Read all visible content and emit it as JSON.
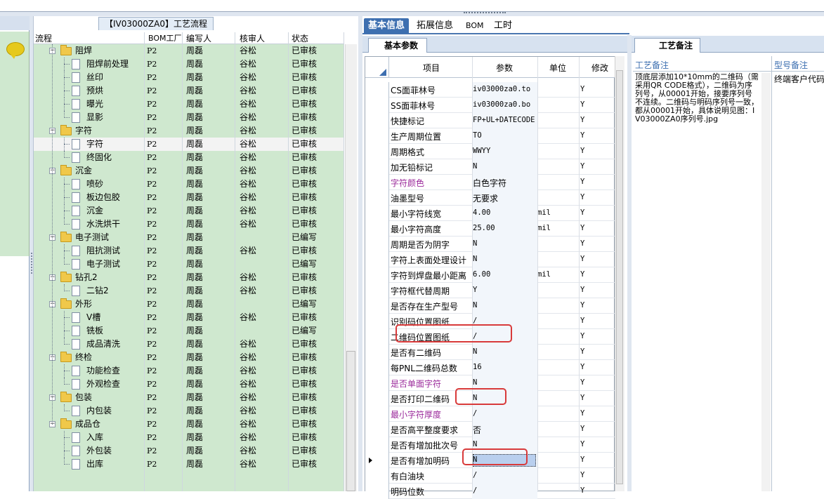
{
  "tree": {
    "title": "【IV03000ZA0】工艺流程",
    "headers": {
      "flow": "流程",
      "bom": "BOM工厂",
      "writer": "编写人",
      "checker": "核审人",
      "status": "状态"
    },
    "rows": [
      {
        "type": "folder",
        "name": "阻焊",
        "bom": "P2",
        "writer": "周磊",
        "checker": "谷松",
        "status": "已审核"
      },
      {
        "type": "doc",
        "name": "阻焊前处理",
        "bom": "P2",
        "writer": "周磊",
        "checker": "谷松",
        "status": "已审核"
      },
      {
        "type": "doc",
        "name": "丝印",
        "bom": "P2",
        "writer": "周磊",
        "checker": "谷松",
        "status": "已审核"
      },
      {
        "type": "doc",
        "name": "预烘",
        "bom": "P2",
        "writer": "周磊",
        "checker": "谷松",
        "status": "已审核"
      },
      {
        "type": "doc",
        "name": "曝光",
        "bom": "P2",
        "writer": "周磊",
        "checker": "谷松",
        "status": "已审核"
      },
      {
        "type": "doc",
        "name": "显影",
        "bom": "P2",
        "writer": "周磊",
        "checker": "谷松",
        "status": "已审核",
        "last": true
      },
      {
        "type": "folder",
        "name": "字符",
        "bom": "P2",
        "writer": "周磊",
        "checker": "谷松",
        "status": "已审核"
      },
      {
        "type": "doc",
        "name": "字符",
        "bom": "P2",
        "writer": "周磊",
        "checker": "谷松",
        "status": "已审核",
        "selected": true
      },
      {
        "type": "doc",
        "name": "终固化",
        "bom": "P2",
        "writer": "周磊",
        "checker": "谷松",
        "status": "已审核",
        "last": true
      },
      {
        "type": "folder",
        "name": "沉金",
        "bom": "P2",
        "writer": "周磊",
        "checker": "谷松",
        "status": "已审核"
      },
      {
        "type": "doc",
        "name": "喷砂",
        "bom": "P2",
        "writer": "周磊",
        "checker": "谷松",
        "status": "已审核"
      },
      {
        "type": "doc",
        "name": "板边包胶",
        "bom": "P2",
        "writer": "周磊",
        "checker": "谷松",
        "status": "已审核"
      },
      {
        "type": "doc",
        "name": "沉金",
        "bom": "P2",
        "writer": "周磊",
        "checker": "谷松",
        "status": "已审核"
      },
      {
        "type": "doc",
        "name": "水洗烘干",
        "bom": "P2",
        "writer": "周磊",
        "checker": "谷松",
        "status": "已审核",
        "last": true
      },
      {
        "type": "folder",
        "name": "电子测试",
        "bom": "P2",
        "writer": "周磊",
        "checker": "",
        "status": "已编写"
      },
      {
        "type": "doc",
        "name": "阻抗测试",
        "bom": "P2",
        "writer": "周磊",
        "checker": "谷松",
        "status": "已审核"
      },
      {
        "type": "doc",
        "name": "电子测试",
        "bom": "P2",
        "writer": "周磊",
        "checker": "",
        "status": "已编写",
        "last": true
      },
      {
        "type": "folder",
        "name": "钻孔2",
        "bom": "P2",
        "writer": "周磊",
        "checker": "谷松",
        "status": "已审核"
      },
      {
        "type": "doc",
        "name": "二钻2",
        "bom": "P2",
        "writer": "周磊",
        "checker": "谷松",
        "status": "已审核",
        "last": true
      },
      {
        "type": "folder",
        "name": "外形",
        "bom": "P2",
        "writer": "周磊",
        "checker": "",
        "status": "已编写"
      },
      {
        "type": "doc",
        "name": "V槽",
        "bom": "P2",
        "writer": "周磊",
        "checker": "谷松",
        "status": "已审核"
      },
      {
        "type": "doc",
        "name": "铣板",
        "bom": "P2",
        "writer": "周磊",
        "checker": "",
        "status": "已编写"
      },
      {
        "type": "doc",
        "name": "成品清洗",
        "bom": "P2",
        "writer": "周磊",
        "checker": "谷松",
        "status": "已审核",
        "last": true
      },
      {
        "type": "folder",
        "name": "终检",
        "bom": "P2",
        "writer": "周磊",
        "checker": "谷松",
        "status": "已审核"
      },
      {
        "type": "doc",
        "name": "功能检查",
        "bom": "P2",
        "writer": "周磊",
        "checker": "谷松",
        "status": "已审核"
      },
      {
        "type": "doc",
        "name": "外观检查",
        "bom": "P2",
        "writer": "周磊",
        "checker": "谷松",
        "status": "已审核",
        "last": true
      },
      {
        "type": "folder",
        "name": "包装",
        "bom": "P2",
        "writer": "周磊",
        "checker": "谷松",
        "status": "已审核"
      },
      {
        "type": "doc",
        "name": "内包装",
        "bom": "P2",
        "writer": "周磊",
        "checker": "谷松",
        "status": "已审核",
        "last": true
      },
      {
        "type": "folder",
        "name": "成品仓",
        "bom": "P2",
        "writer": "周磊",
        "checker": "谷松",
        "status": "已审核",
        "lastfolder": true
      },
      {
        "type": "doc",
        "name": "入库",
        "bom": "P2",
        "writer": "周磊",
        "checker": "谷松",
        "status": "已审核"
      },
      {
        "type": "doc",
        "name": "外包装",
        "bom": "P2",
        "writer": "周磊",
        "checker": "谷松",
        "status": "已审核"
      },
      {
        "type": "doc",
        "name": "出库",
        "bom": "P2",
        "writer": "周磊",
        "checker": "谷松",
        "status": "已审核",
        "last": true
      }
    ]
  },
  "tabs": [
    {
      "label": "基本信息",
      "active": true
    },
    {
      "label": "拓展信息",
      "active": false
    },
    {
      "label": "BOM",
      "active": false
    },
    {
      "label": "工时",
      "active": false
    }
  ],
  "subtab": "基本参数",
  "params": {
    "headers": {
      "item": "项目",
      "param": "参数",
      "unit": "单位",
      "mod": "修改"
    },
    "rows": [
      {
        "item": "CS面菲林号",
        "param": "iv03000za0.to",
        "unit": "",
        "mod": "Y"
      },
      {
        "item": "SS面菲林号",
        "param": "iv03000za0.bo",
        "unit": "",
        "mod": "Y"
      },
      {
        "item": "快捷标记",
        "param": "FP+UL+DATECODE",
        "unit": "",
        "mod": "Y"
      },
      {
        "item": "生产周期位置",
        "param": "TO",
        "unit": "",
        "mod": "Y"
      },
      {
        "item": "周期格式",
        "param": "WWYY",
        "unit": "",
        "mod": "Y"
      },
      {
        "item": "加无铅标记",
        "param": "N",
        "unit": "",
        "mod": "Y"
      },
      {
        "item": "字符颜色",
        "param": "白色字符",
        "unit": "",
        "mod": "Y",
        "purple": true,
        "cn": true
      },
      {
        "item": "油墨型号",
        "param": "无要求",
        "unit": "",
        "mod": "Y",
        "cn": true
      },
      {
        "item": "最小字符线宽",
        "param": "4.00",
        "unit": "mil",
        "mod": "Y"
      },
      {
        "item": "最小字符高度",
        "param": "25.00",
        "unit": "mil",
        "mod": "Y"
      },
      {
        "item": "周期是否为阴字",
        "param": "N",
        "unit": "",
        "mod": "Y"
      },
      {
        "item": "字符上表面处理设计",
        "param": "N",
        "unit": "",
        "mod": "Y"
      },
      {
        "item": "字符到焊盘最小距离",
        "param": "6.00",
        "unit": "mil",
        "mod": "Y"
      },
      {
        "item": "字符框代替周期",
        "param": "Y",
        "unit": "",
        "mod": "Y"
      },
      {
        "item": "是否存在生产型号",
        "param": "N",
        "unit": "",
        "mod": "Y"
      },
      {
        "item": "识别码位置图纸",
        "param": "/",
        "unit": "",
        "mod": "Y"
      },
      {
        "item": "二维码位置图纸",
        "param": "/",
        "unit": "",
        "mod": "Y"
      },
      {
        "item": "是否有二维码",
        "param": "N",
        "unit": "",
        "mod": "Y"
      },
      {
        "item": "每PNL二维码总数",
        "param": "16",
        "unit": "",
        "mod": "Y"
      },
      {
        "item": "是否单面字符",
        "param": "N",
        "unit": "",
        "mod": "Y",
        "purple": true
      },
      {
        "item": "是否打印二维码",
        "param": "N",
        "unit": "",
        "mod": "Y"
      },
      {
        "item": "最小字符厚度",
        "param": "/",
        "unit": "",
        "mod": "Y",
        "purple": true
      },
      {
        "item": "是否高平整度要求",
        "param": "否",
        "unit": "",
        "mod": "Y",
        "cn": true
      },
      {
        "item": "是否有增加批次号",
        "param": "N",
        "unit": "",
        "mod": "Y"
      },
      {
        "item": "是否有增加明码",
        "param": "N",
        "unit": "",
        "mod": "Y",
        "current": true
      },
      {
        "item": "有白油块",
        "param": "/",
        "unit": "",
        "mod": "Y"
      },
      {
        "item": "明码位数",
        "param": "/",
        "unit": "",
        "mod": "Y"
      }
    ]
  },
  "right": {
    "tab": "工艺备注",
    "headers": {
      "note": "工艺备注",
      "model_note": "型号备注"
    },
    "note": "顶底层添加10*10mm的二维码（需采用QR CODE格式），二维码为序列号，从00001开始，接要序列号不连续。二维码与明码序列号一致，都从00001开始，具体说明见图：IV03000ZA0序列号.jpg",
    "model_note": "终端客户代码"
  },
  "colors": {
    "tree_bg": "#cfe8cf",
    "tab_active": "#3d6fb0",
    "highlight_box": "#d83a3a",
    "purple_text": "#9b2a9b"
  }
}
